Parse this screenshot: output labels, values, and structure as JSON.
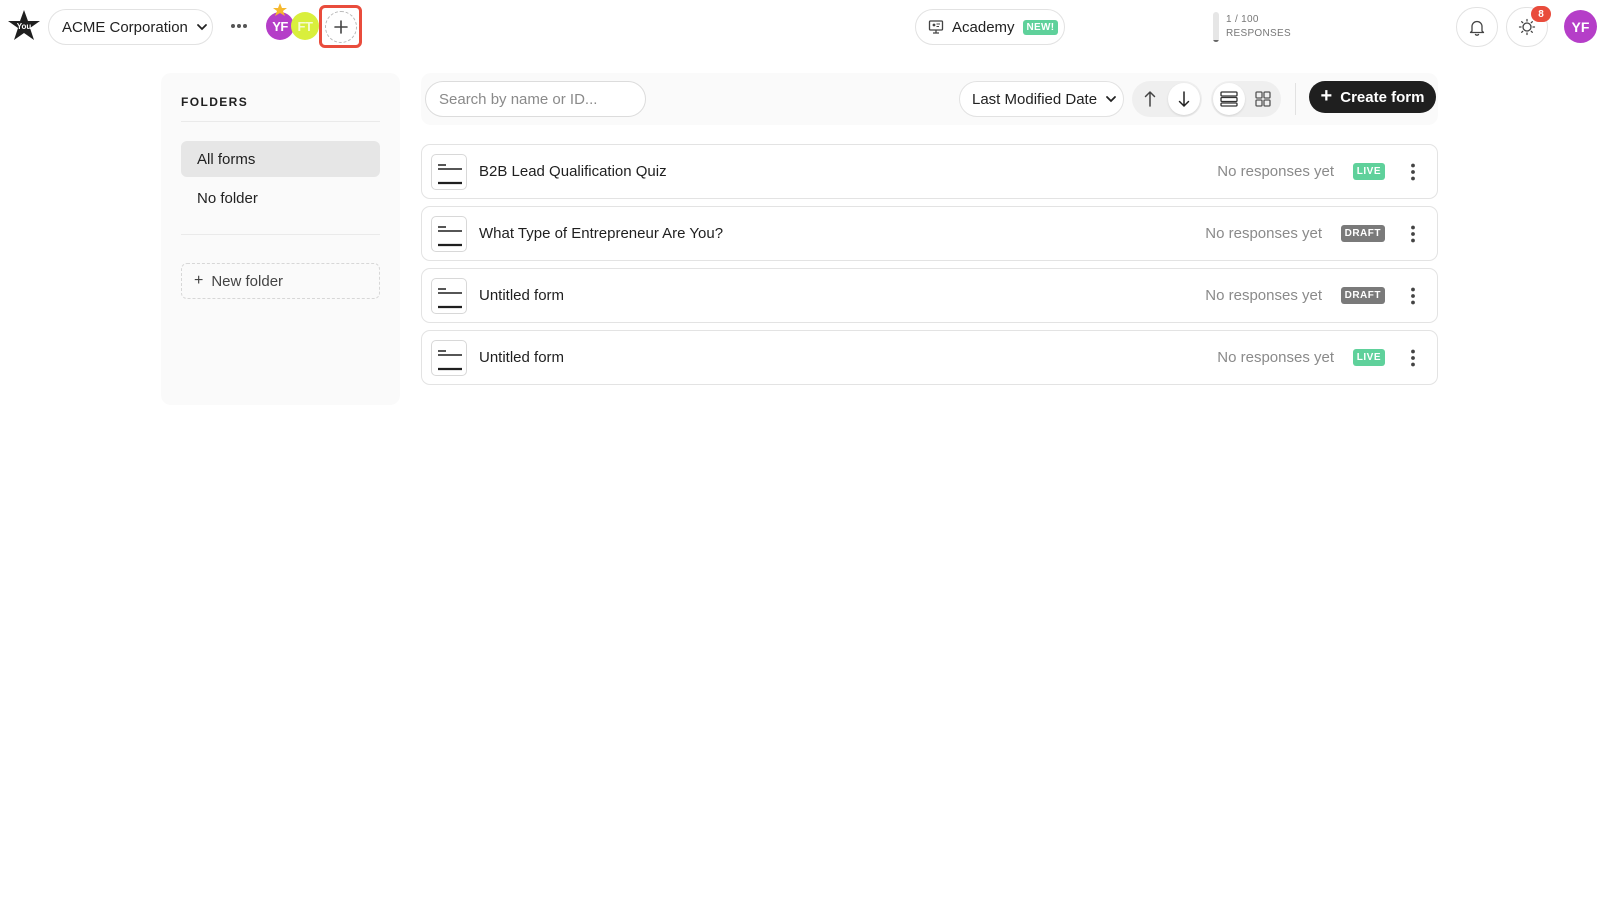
{
  "topbar": {
    "workspace_name": "ACME Corporation",
    "collaborators": [
      {
        "initials": "YF",
        "color": "#b53ec8"
      },
      {
        "initials": "FT",
        "color": "#d9ef3c"
      }
    ],
    "academy_label": "Academy",
    "academy_badge": "NEW!",
    "usage_count": "1 / 100",
    "usage_label": "RESPONSES",
    "usage_fraction": 0.01,
    "notification_count": "8",
    "user_initials": "YF"
  },
  "sidebar": {
    "title": "FOLDERS",
    "items": [
      {
        "label": "All forms",
        "active": true
      },
      {
        "label": "No folder",
        "active": false
      }
    ],
    "new_folder_label": "New folder"
  },
  "toolbar": {
    "search_placeholder": "Search by name or ID...",
    "sort_label": "Last Modified Date",
    "create_label": "Create form"
  },
  "forms": [
    {
      "name": "B2B Lead Qualification Quiz",
      "responses": "No responses yet",
      "status": "LIVE"
    },
    {
      "name": "What Type of Entrepreneur Are You?",
      "responses": "No responses yet",
      "status": "DRAFT"
    },
    {
      "name": "Untitled form",
      "responses": "No responses yet",
      "status": "DRAFT"
    },
    {
      "name": "Untitled form",
      "responses": "No responses yet",
      "status": "LIVE"
    }
  ],
  "colors": {
    "accent_dark": "#1f1f1f",
    "live_green": "#5fd19b",
    "draft_gray": "#7a7a7a",
    "highlight_red": "#e94c3c",
    "avatar_purple": "#b53ec8"
  }
}
